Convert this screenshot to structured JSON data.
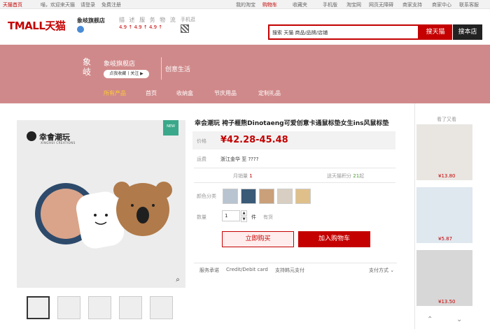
{
  "topbar": {
    "home": "天猫首页",
    "greeting": "喵，欢迎来天猫",
    "login": "请登录",
    "register": "免费注册",
    "my_taobao": "我的淘宝",
    "cart": "购物车",
    "favorites": "收藏夹",
    "mobile": "手机版",
    "taobao": "淘宝网",
    "no_barrier": "网页无障碍",
    "service": "商家支持",
    "merchant": "商家中心",
    "contact": "联系客服"
  },
  "header": {
    "logo": "TMALL天猫",
    "shop_name": "象岐旗舰店",
    "rating_labels": "描 述  服 务  物 流",
    "ratings": [
      "4.9 ↑",
      "4.9 ↑",
      "4.9 ↑"
    ],
    "phone_label": "手机逛",
    "search_placeholder": "搜索 天猫 商品/品牌/店铺",
    "search_tmall": "搜天猫",
    "search_shop": "搜本店"
  },
  "banner": {
    "logo_text": "象岐",
    "shop_name": "象岐旗舰店",
    "fav_button": "点我收藏丨关注 ▶",
    "slogan": "创意生活",
    "color": "#d0898a"
  },
  "nav": {
    "items": [
      {
        "label": "所有产品",
        "active": true
      },
      {
        "label": "首页",
        "active": false
      },
      {
        "label": "收纳盒",
        "active": false
      },
      {
        "label": "节庆用品",
        "active": false
      },
      {
        "label": "定制礼品",
        "active": false
      }
    ]
  },
  "product": {
    "title": "幸会潮玩 袴子榧熊Dinotaeng可爱创意卡通鼠标垫女生ins风鼠标垫",
    "brand": "幸會潮玩",
    "brand_sub": "XINGHUI CREATIONS",
    "new_tag": "NEW",
    "price_label": "价格",
    "price": "¥42.28-45.48",
    "ship_label": "运费",
    "ship_value": "浙江金华 至 ????",
    "monthly_sales_label": "月销量",
    "monthly_sales": "1",
    "points_label": "送天猫积分",
    "points": "21",
    "points_suffix": "起",
    "color_label": "颜色分类",
    "qty_label": "数量",
    "qty_value": "1",
    "qty_unit": "件",
    "stock": "有货",
    "buy_now": "立即购买",
    "add_cart": "加入购物车",
    "promise_label": "服务承诺",
    "promise_card": "Credit/Debit card",
    "promise_pay": "支持韩元支付",
    "payment": "支付方式 ⌄"
  },
  "side": {
    "title": "看了又看",
    "items": [
      {
        "price": "¥13.80"
      },
      {
        "price": "¥5.87"
      },
      {
        "price": "¥13.50"
      }
    ]
  }
}
